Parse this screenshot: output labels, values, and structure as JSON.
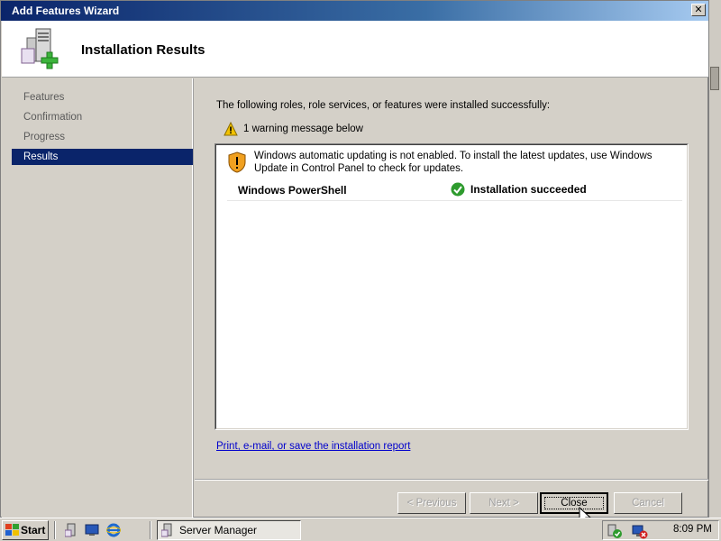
{
  "window": {
    "title": "Add Features Wizard",
    "close_label": "✕"
  },
  "header": {
    "heading": "Installation Results",
    "icon": "server-add-icon"
  },
  "nav": {
    "items": [
      {
        "label": "Features",
        "active": false
      },
      {
        "label": "Confirmation",
        "active": false
      },
      {
        "label": "Progress",
        "active": false
      },
      {
        "label": "Results",
        "active": true
      }
    ]
  },
  "main": {
    "intro": "The following roles, role services, or features were installed successfully:",
    "warning_summary": "1 warning message below",
    "warning_message": "Windows automatic updating is not enabled. To install the latest updates, use Windows Update in Control Panel to check for updates.",
    "feature_name": "Windows PowerShell",
    "feature_status": "Installation succeeded",
    "report_link": "Print, e-mail, or save the installation report"
  },
  "buttons": {
    "previous": "< Previous",
    "next": "Next >",
    "close": "Close",
    "cancel": "Cancel"
  },
  "taskbar": {
    "start": "Start",
    "task": "Server Manager",
    "clock": "8:09 PM"
  },
  "colors": {
    "title_gradient_start": "#0a246a",
    "nav_active": "#0a246a",
    "link": "#0000cc",
    "success": "#2e9b2e",
    "warning": "#f2c200"
  }
}
